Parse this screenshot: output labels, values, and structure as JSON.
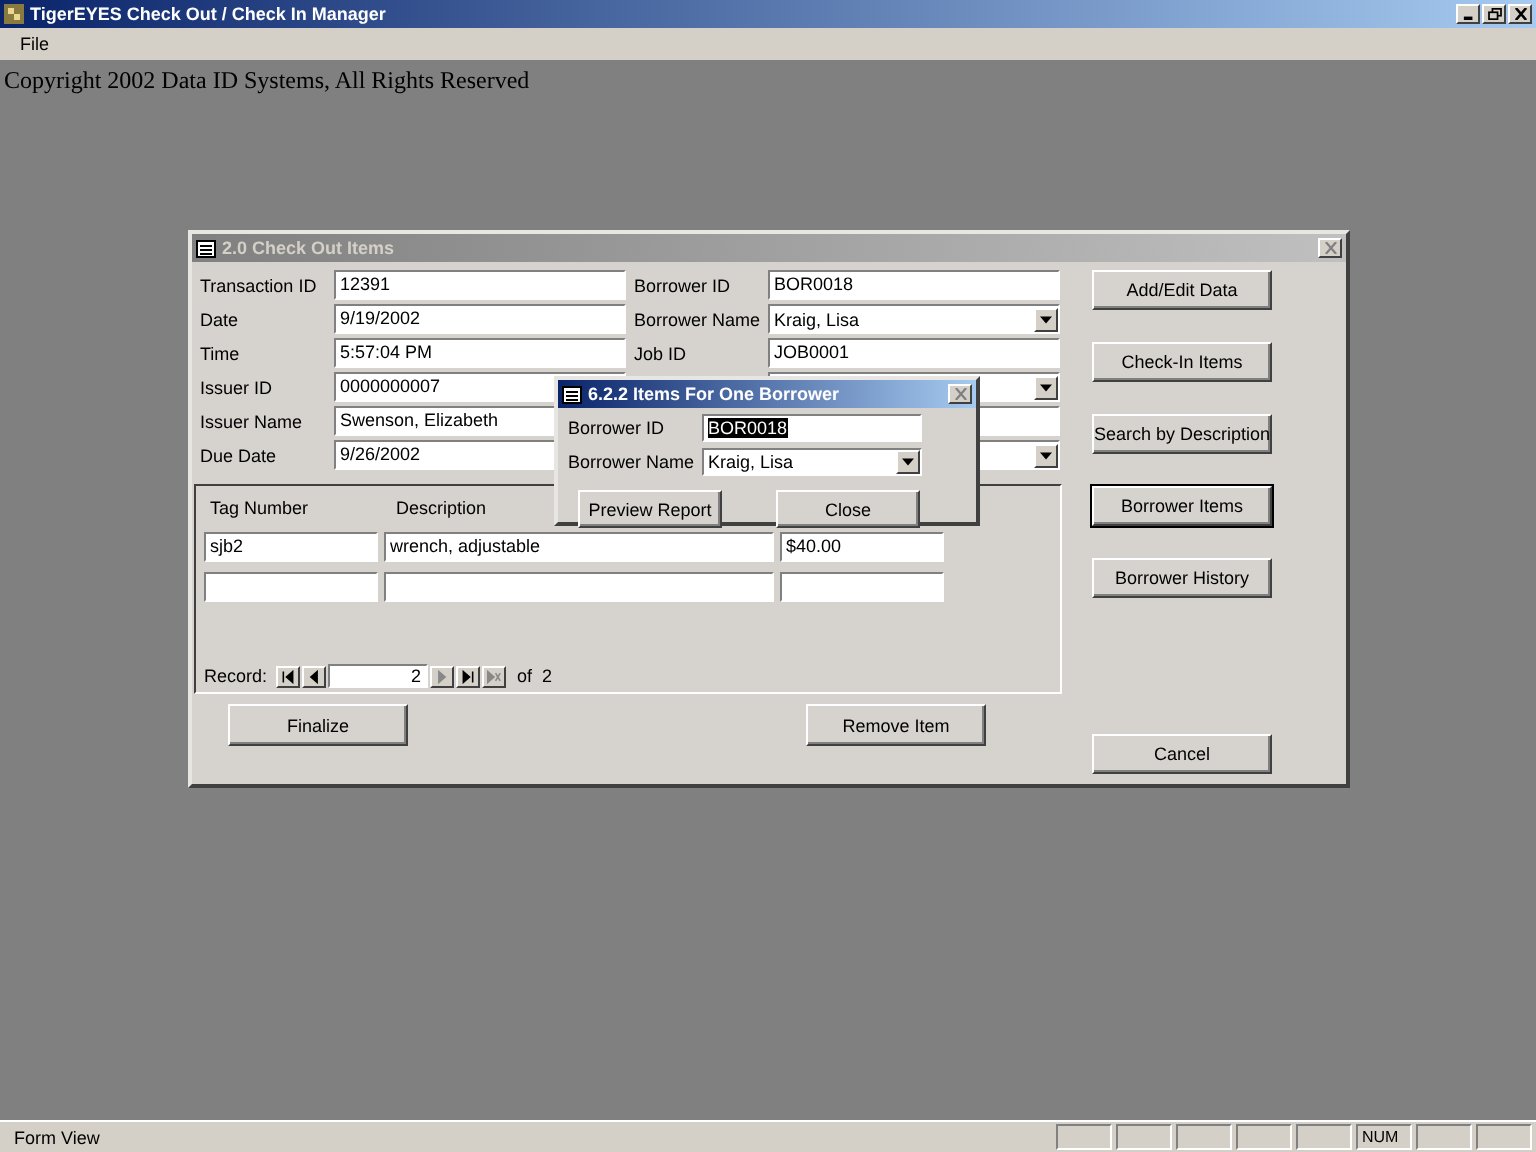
{
  "window": {
    "title": "TigerEYES Check Out / Check In Manager"
  },
  "menu": [
    {
      "label": "File"
    }
  ],
  "copyright": "Copyright 2002 Data ID Systems, All Rights Reserved",
  "form": {
    "title": "2.0  Check Out Items",
    "active": false,
    "left_fields": [
      {
        "label": "Transaction ID",
        "value": "12391",
        "kind": "text"
      },
      {
        "label": "Date",
        "value": "9/19/2002",
        "kind": "text"
      },
      {
        "label": "Time",
        "value": "5:57:04 PM",
        "kind": "text"
      },
      {
        "label": "Issuer ID",
        "value": "0000000007",
        "kind": "text"
      },
      {
        "label": "Issuer Name",
        "value": "Swenson, Elizabeth",
        "kind": "text"
      },
      {
        "label": "Due Date",
        "value": "9/26/2002",
        "kind": "text"
      }
    ],
    "right_fields": [
      {
        "label": "Borrower ID",
        "value": "BOR0018",
        "kind": "text"
      },
      {
        "label": "Borrower Name",
        "value": "Kraig, Lisa",
        "kind": "combo"
      },
      {
        "label": "Job ID",
        "value": "JOB0001",
        "kind": "text"
      },
      {
        "kind": "combo"
      },
      {
        "kind": "text"
      },
      {
        "kind": "combo"
      }
    ],
    "subform": {
      "columns": [
        "Tag Number",
        "Description"
      ],
      "rows": [
        {
          "cells": [
            "sjb2",
            "wrench, adjustable",
            "$40.00"
          ]
        }
      ],
      "record": {
        "label": "Record:",
        "current": "2",
        "of": "of",
        "total": "2",
        "nav": [
          {
            "kind": "first",
            "disabled": false
          },
          {
            "kind": "prev",
            "disabled": false
          },
          {
            "kind": "next",
            "disabled": true
          },
          {
            "kind": "last",
            "disabled": false
          },
          {
            "kind": "new",
            "disabled": true
          }
        ]
      }
    },
    "side_buttons": [
      {
        "label": "Add/Edit Data",
        "default": false
      },
      {
        "label": "Check-In Items",
        "default": false
      },
      {
        "label": "Search by Description",
        "default": false
      },
      {
        "label": "Borrower Items",
        "default": true
      },
      {
        "label": "Borrower History",
        "default": false
      }
    ],
    "bottom_buttons": [
      {
        "label": "Finalize"
      },
      {
        "label": "Remove Item"
      }
    ],
    "cancel": {
      "label": "Cancel"
    }
  },
  "dialog": {
    "title": "6.2.2  Items For One Borrower",
    "active": true,
    "fields": [
      {
        "label": "Borrower ID",
        "value": "BOR0018",
        "kind": "text",
        "selected": true
      },
      {
        "label": "Borrower Name",
        "value": "Kraig, Lisa",
        "kind": "combo",
        "selected": false
      }
    ],
    "buttons": [
      {
        "label": "Preview Report"
      },
      {
        "label": "Close"
      }
    ]
  },
  "status_bar": {
    "text": "Form View",
    "indicator": "NUM"
  }
}
